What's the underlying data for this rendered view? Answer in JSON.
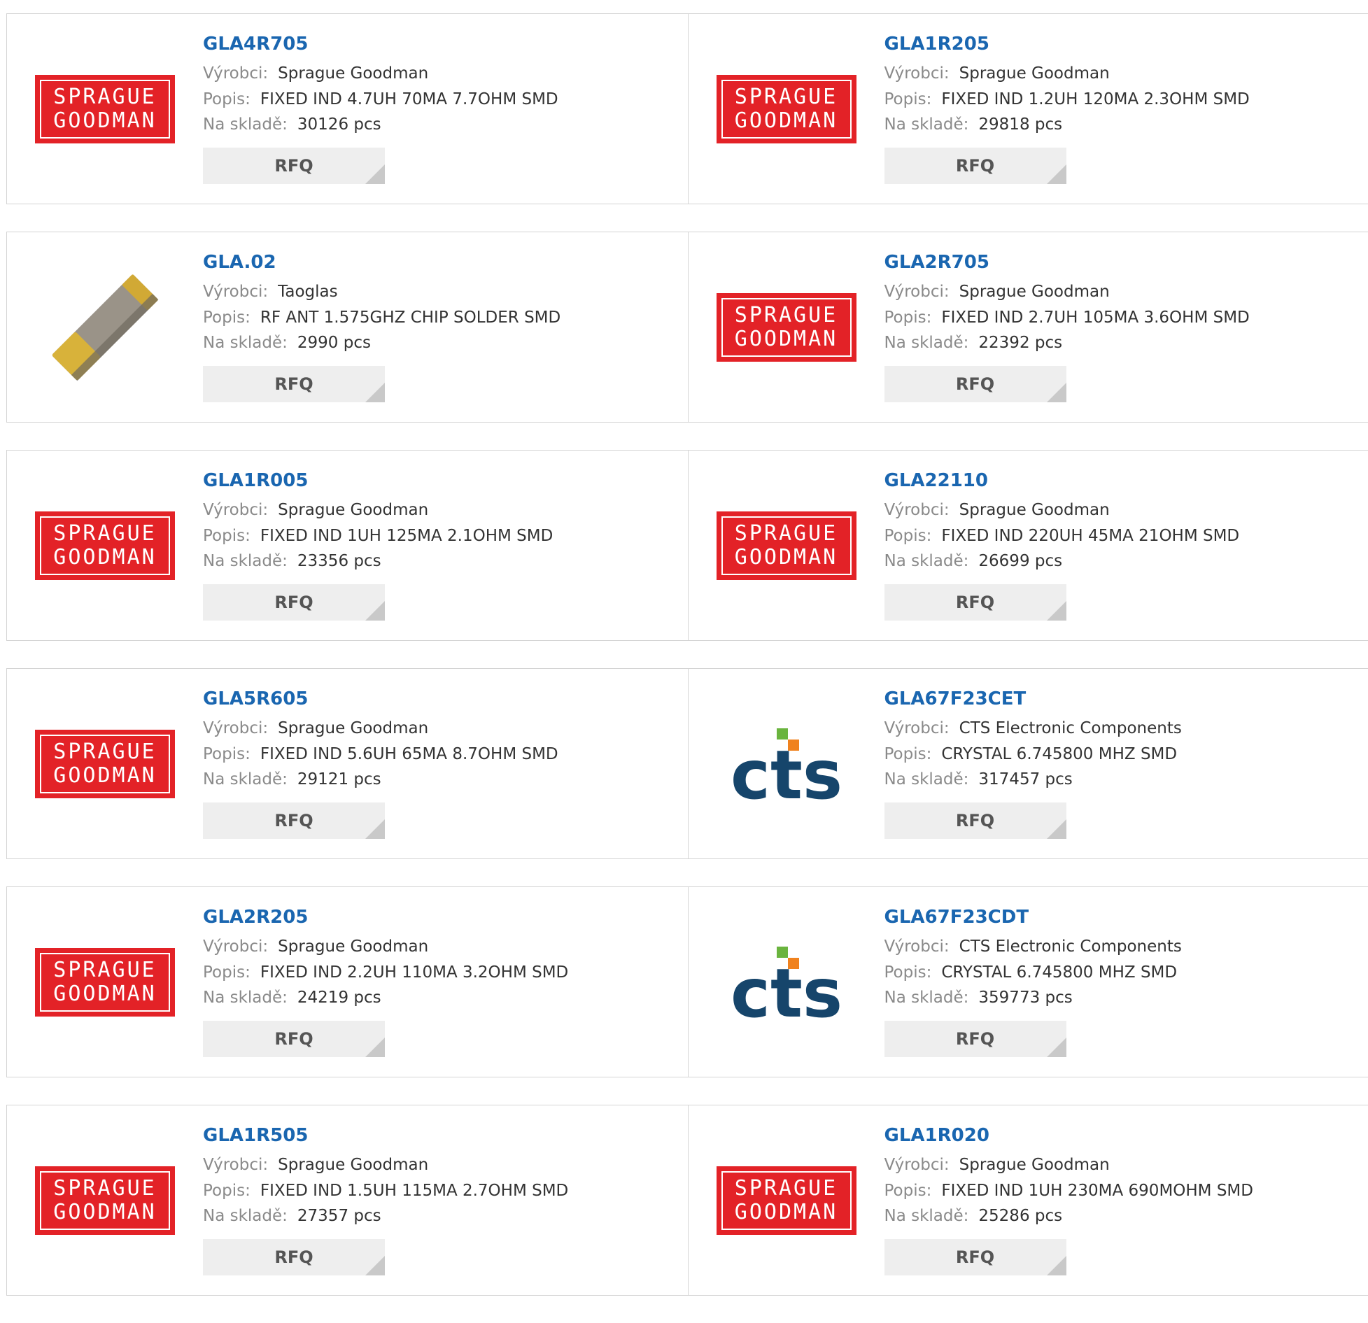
{
  "labels": {
    "manufacturer": "Výrobci:",
    "description": "Popis:",
    "stock": "Na skladě:",
    "rfq": "RFQ"
  },
  "colors": {
    "part_link": "#1a66b0",
    "sprague_red": "#e32227",
    "cts_navy": "#16456b",
    "cts_green": "#6ab43e",
    "cts_orange": "#f0821e"
  },
  "logos": {
    "sprague": {
      "line1": "SPRAGUE",
      "line2": "GOODMAN"
    },
    "cts": {
      "text": "cts"
    }
  },
  "products": [
    {
      "part": "GLA4R705",
      "manufacturer": "Sprague Goodman",
      "description": "FIXED IND 4.7UH 70MA 7.7OHM SMD",
      "stock": "30126 pcs",
      "logo": "sprague"
    },
    {
      "part": "GLA1R205",
      "manufacturer": "Sprague Goodman",
      "description": "FIXED IND 1.2UH 120MA 2.3OHM SMD",
      "stock": "29818 pcs",
      "logo": "sprague"
    },
    {
      "part": "GLA.02",
      "manufacturer": "Taoglas",
      "description": "RF ANT 1.575GHZ CHIP SOLDER SMD",
      "stock": "2990 pcs",
      "logo": "chip"
    },
    {
      "part": "GLA2R705",
      "manufacturer": "Sprague Goodman",
      "description": "FIXED IND 2.7UH 105MA 3.6OHM SMD",
      "stock": "22392 pcs",
      "logo": "sprague"
    },
    {
      "part": "GLA1R005",
      "manufacturer": "Sprague Goodman",
      "description": "FIXED IND 1UH 125MA 2.1OHM SMD",
      "stock": "23356 pcs",
      "logo": "sprague"
    },
    {
      "part": "GLA22110",
      "manufacturer": "Sprague Goodman",
      "description": "FIXED IND 220UH 45MA 21OHM SMD",
      "stock": "26699 pcs",
      "logo": "sprague"
    },
    {
      "part": "GLA5R605",
      "manufacturer": "Sprague Goodman",
      "description": "FIXED IND 5.6UH 65MA 8.7OHM SMD",
      "stock": "29121 pcs",
      "logo": "sprague"
    },
    {
      "part": "GLA67F23CET",
      "manufacturer": "CTS Electronic Components",
      "description": "CRYSTAL 6.745800 MHZ SMD",
      "stock": "317457 pcs",
      "logo": "cts"
    },
    {
      "part": "GLA2R205",
      "manufacturer": "Sprague Goodman",
      "description": "FIXED IND 2.2UH 110MA 3.2OHM SMD",
      "stock": "24219 pcs",
      "logo": "sprague"
    },
    {
      "part": "GLA67F23CDT",
      "manufacturer": "CTS Electronic Components",
      "description": "CRYSTAL 6.745800 MHZ SMD",
      "stock": "359773 pcs",
      "logo": "cts"
    },
    {
      "part": "GLA1R505",
      "manufacturer": "Sprague Goodman",
      "description": "FIXED IND 1.5UH 115MA 2.7OHM SMD",
      "stock": "27357 pcs",
      "logo": "sprague"
    },
    {
      "part": "GLA1R020",
      "manufacturer": "Sprague Goodman",
      "description": "FIXED IND 1UH 230MA 690MOHM SMD",
      "stock": "25286 pcs",
      "logo": "sprague"
    }
  ]
}
